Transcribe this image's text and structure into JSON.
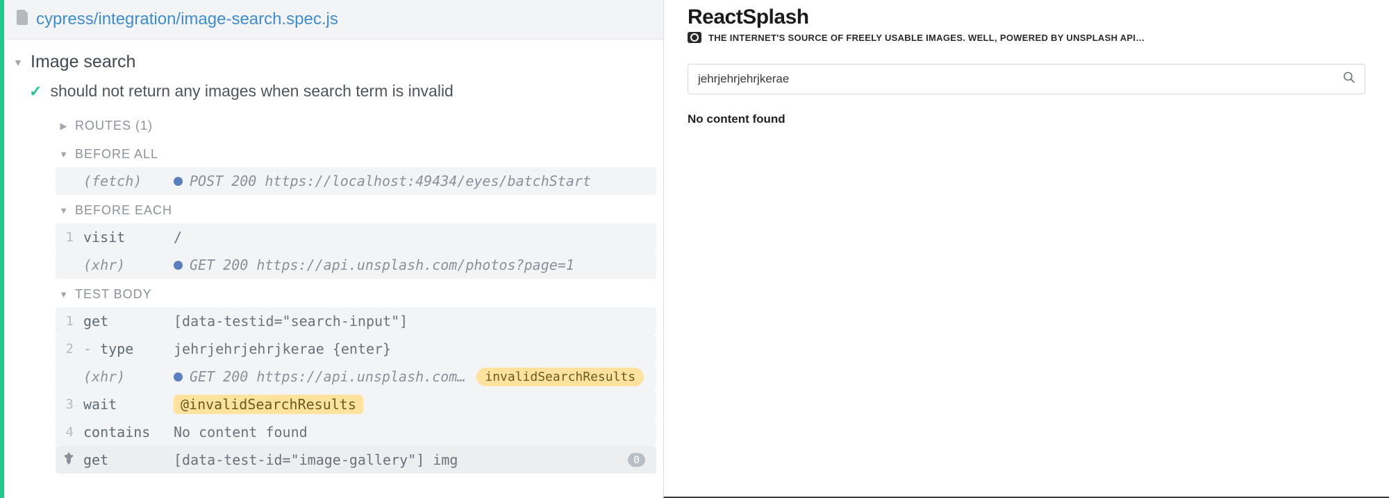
{
  "spec": {
    "path": "cypress/integration/image-search.spec.js",
    "describe": "Image search",
    "test": "should not return any images when search term is invalid"
  },
  "sections": {
    "routes": "ROUTES (1)",
    "beforeAll": "BEFORE ALL",
    "beforeEach": "BEFORE EACH",
    "testBody": "TEST BODY"
  },
  "commands": {
    "beforeAll": [
      {
        "num": "",
        "name": "(fetch)",
        "nameItalic": true,
        "dot": true,
        "msg": "POST 200 https://localhost:49434/eyes/batchStart",
        "msgItalic": true
      }
    ],
    "beforeEach": [
      {
        "num": "1",
        "name": "visit",
        "msg": "/"
      },
      {
        "num": "",
        "name": "(xhr)",
        "nameItalic": true,
        "dot": true,
        "msg": "GET 200 https://api.unsplash.com/photos?page=1",
        "msgItalic": true
      }
    ],
    "testBody": [
      {
        "num": "1",
        "name": "get",
        "msg": "[data-testid=\"search-input\"]"
      },
      {
        "num": "2",
        "name": "type",
        "child": true,
        "msg": "jehrjehrjehrjkerae {enter}"
      },
      {
        "num": "",
        "name": "(xhr)",
        "nameItalic": true,
        "dot": true,
        "msg": "GET 200 https://api.unsplash.com…",
        "msgItalic": true,
        "alias": "invalidSearchResults"
      },
      {
        "num": "3",
        "name": "wait",
        "aliasRef": "@invalidSearchResults"
      },
      {
        "num": "4",
        "name": "contains",
        "msg": "No content found"
      },
      {
        "pin": true,
        "name": "get",
        "msg": "[data-test-id=\"image-gallery\"] img",
        "count": "0"
      }
    ]
  },
  "app": {
    "title": "ReactSplash",
    "tagline": "THE INTERNET'S SOURCE OF FREELY USABLE IMAGES. WELL, POWERED BY UNSPLASH API…",
    "searchValue": "jehrjehrjehrjkerae",
    "noContent": "No content found"
  }
}
